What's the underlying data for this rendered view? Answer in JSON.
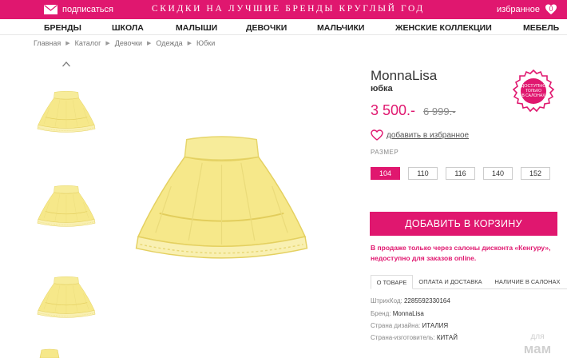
{
  "topbar": {
    "subscribe_label": "подписаться",
    "promo_text": "СКИДКИ НА ЛУЧШИЕ БРЕНДЫ КРУГЛЫЙ ГОД",
    "favorites_label": "избранное",
    "favorites_count": "0",
    "background_color": "#e0176f"
  },
  "nav": {
    "items": [
      {
        "label": "БРЕНДЫ"
      },
      {
        "label": "ШКОЛА"
      },
      {
        "label": "МАЛЫШИ"
      },
      {
        "label": "ДЕВОЧКИ"
      },
      {
        "label": "МАЛЬЧИКИ"
      },
      {
        "label": "ЖЕНСКИЕ КОЛЛЕКЦИИ"
      },
      {
        "label": "МЕБЕЛЬ"
      }
    ]
  },
  "breadcrumb": [
    "Главная",
    "Каталог",
    "Девочки",
    "Одежда",
    "Юбки"
  ],
  "product": {
    "brand": "MonnaLisa",
    "type": "юбка",
    "stamp_text": [
      "ДОСТУПНО",
      "ТОЛЬКО",
      "В САЛОНАХ"
    ],
    "price_current": "3 500.-",
    "price_old": "6 999.-",
    "add_to_favorites": "добавить в избранное",
    "size_label": "РАЗМЕР",
    "sizes": [
      {
        "label": "104",
        "selected": true
      },
      {
        "label": "110",
        "selected": false
      },
      {
        "label": "116",
        "selected": false
      },
      {
        "label": "140",
        "selected": false
      },
      {
        "label": "152",
        "selected": false
      }
    ],
    "add_to_cart": "ДОБАВИТЬ В КОРЗИНУ",
    "notice": "В продаже только через салоны дисконта «Кенгуру», недоступно для заказов online.",
    "tabs": [
      {
        "label": "О ТОВАРЕ",
        "active": true
      },
      {
        "label": "ОПЛАТА И ДОСТАВКА",
        "active": false
      },
      {
        "label": "НАЛИЧИЕ В САЛОНАХ",
        "active": false
      }
    ],
    "attributes": [
      {
        "label": "ШтрихКод:",
        "value": "2285592330164"
      },
      {
        "label": "Бренд:",
        "value": "MonnaLisa"
      },
      {
        "label": "Страна дизайна:",
        "value": "ИТАЛИЯ"
      },
      {
        "label": "Страна-изготовитель:",
        "value": "КИТАЙ"
      }
    ],
    "skirt_color": "#f6e88a"
  },
  "watermark": [
    "для",
    "мам"
  ],
  "icons": [
    "mail-icon",
    "heart-icon",
    "chevron-up-icon",
    "breadcrumb-arrow-icon"
  ]
}
